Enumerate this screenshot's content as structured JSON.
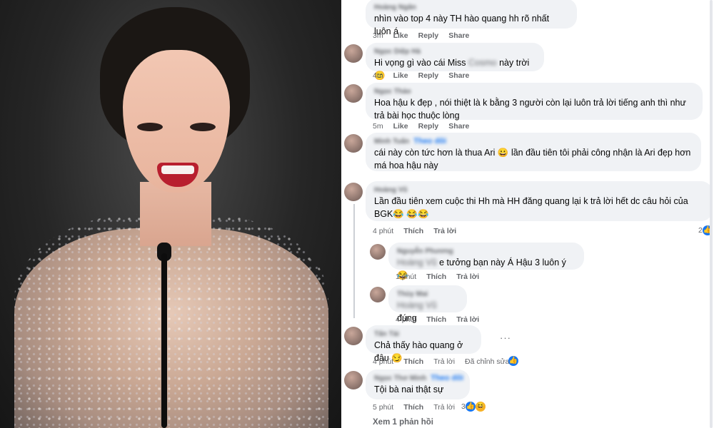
{
  "comments": [
    {
      "author": "Hoàng Ngân",
      "text": "nhìn vào top 4 này TH hào quang hh rõ nhất luôn á",
      "time": "3m",
      "like": "Like",
      "reply": "Reply",
      "share": "Share"
    },
    {
      "author": "Ngọc Diệp Hà",
      "text_before": "Hi vọng gì vào cái Miss",
      "text_blur": "Cosmo",
      "text_after": "này trời 🙂",
      "time": "4m",
      "like": "Like",
      "reply": "Reply",
      "share": "Share"
    },
    {
      "author": "Ngọc Thảo",
      "text": "Hoa hậu k đẹp , nói thiệt là k bằng 3 người còn lại luôn trả lời tiếng anh thì như trả bài học thuộc lòng",
      "time": "5m",
      "like": "Like",
      "reply": "Reply",
      "share": "Share"
    },
    {
      "author": "Minh Tuấn",
      "badge": "Theo dõi",
      "text": "cái này còn tức hơn là thua Ari 😀 lần đầu tiên tôi phải công nhận là Ari đẹp hơn má hoa hậu này"
    },
    {
      "author": "Hoàng Vũ",
      "text": "Lần đầu tiên xem cuộc thi Hh mà HH đăng quang lại k trả lời hết dc câu hỏi của BGK😂 😂😂",
      "time": "4 phút",
      "like": "Thích",
      "reply": "Trả lời",
      "react_count": "2"
    },
    {
      "author": "Nguyễn Phương",
      "mention": "Hoàng Vũ",
      "text": "e tưởng bạn này Á Hậu 3 luôn ý 😂",
      "time": "1 phút",
      "like": "Thích",
      "reply": "Trả lời"
    },
    {
      "author": "Thùy Mai",
      "mention": "Hoàng Vũ",
      "text": "đúng",
      "time": "4 phút",
      "like": "Thích",
      "reply": "Trả lời"
    },
    {
      "author": "Tấn Tài",
      "text": "Chả thấy hào quang ở đâu 😏",
      "time": "4 phút",
      "like": "Thích",
      "reply": "Trả lời",
      "edited": "Đã chỉnh sửa"
    },
    {
      "author": "Ngọc Thơ Minh",
      "badge": "Theo dõi",
      "text": "Tội bà nai thật sự",
      "time": "5 phút",
      "like": "Thích",
      "reply": "Trả lời",
      "react_count": "3"
    }
  ],
  "view_replies": "Xem 1 phản hồi",
  "colors": {
    "bubble": "#f0f2f5",
    "link": "#1877f2",
    "meta": "#65676b"
  },
  "icons": {
    "like": "like-reaction-icon",
    "haha": "haha-reaction-icon",
    "more": "more-options-icon"
  }
}
